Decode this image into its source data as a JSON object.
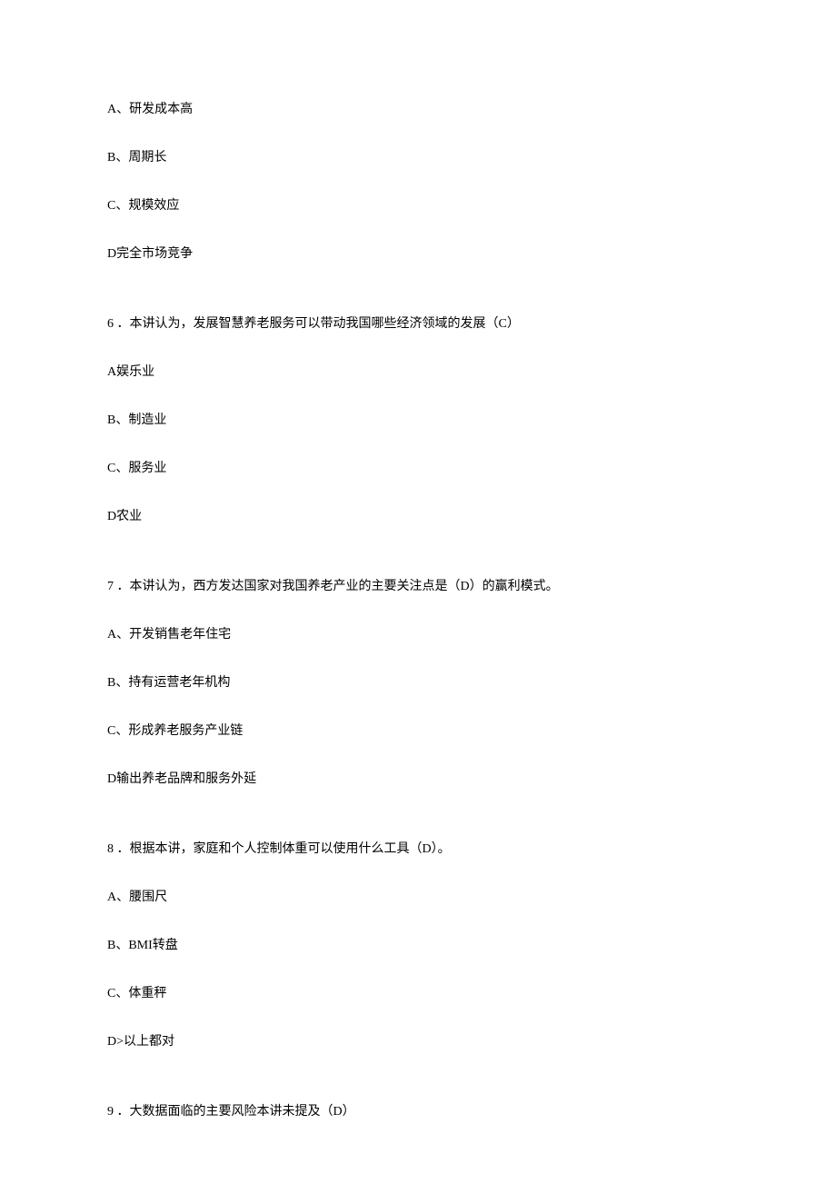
{
  "q5": {
    "options": {
      "a": "A、研发成本高",
      "b": "B、周期长",
      "c": "C、规模效应",
      "d": "D完全市场竞争"
    }
  },
  "q6": {
    "text": "6 ．本讲认为，发展智慧养老服务可以带动我国哪些经济领域的发展（C）",
    "options": {
      "a": "A娱乐业",
      "b": "B、制造业",
      "c": "C、服务业",
      "d": "D农业"
    }
  },
  "q7": {
    "text": "7 ．本讲认为，西方发达国家对我国养老产业的主要关注点是（D）的赢利模式。",
    "options": {
      "a": "A、开发销售老年住宅",
      "b": "B、持有运营老年机构",
      "c": "C、形成养老服务产业链",
      "d": "D输出养老品牌和服务外延"
    }
  },
  "q8": {
    "text": "8 ．根据本讲，家庭和个人控制体重可以使用什么工具（D）。",
    "options": {
      "a": "A、腰围尺",
      "b": "B、BMI转盘",
      "c": "C、体重秤",
      "d": "D>以上都对"
    }
  },
  "q9": {
    "text": "9 ．大数据面临的主要风险本讲未提及（D）"
  }
}
